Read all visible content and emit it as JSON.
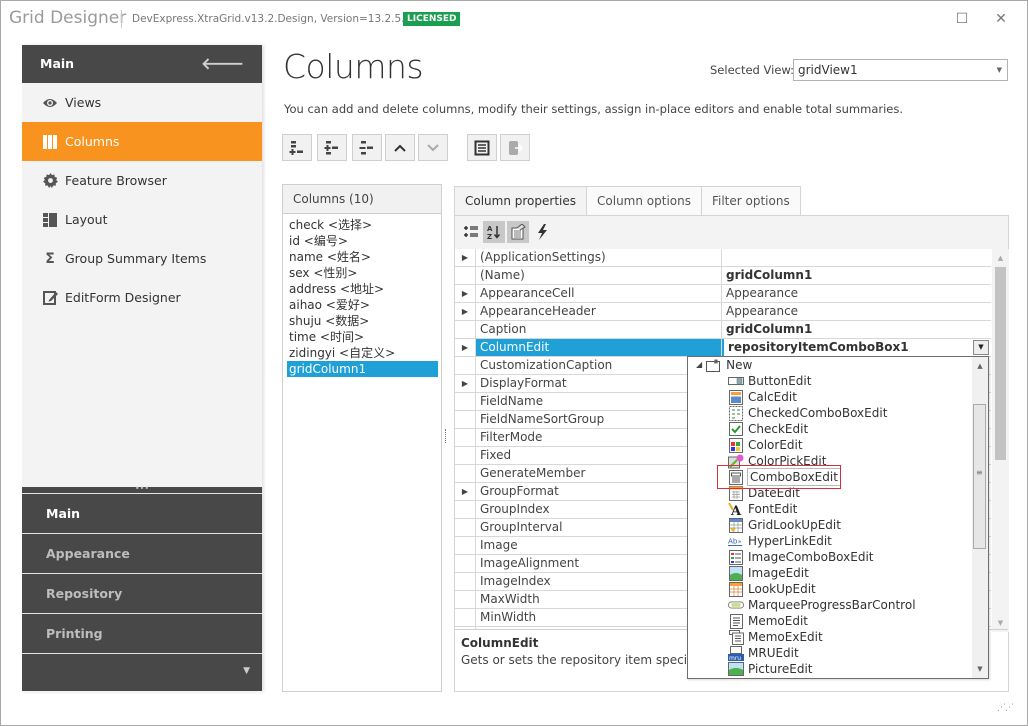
{
  "titlebar": {
    "app_title": "Grid Designer",
    "version": "DevExpress.XtraGrid.v13.2.Design, Version=13.2.5.0",
    "license_badge": "LICENSED",
    "maximize_glyph": "☐",
    "close_glyph": "✕"
  },
  "sidebar": {
    "header": "Main",
    "back_glyph": "🡐",
    "items": [
      {
        "label": "Views",
        "icon": "eye-icon",
        "active": false
      },
      {
        "label": "Columns",
        "icon": "columns-icon",
        "active": true
      },
      {
        "label": "Feature Browser",
        "icon": "gear-icon",
        "active": false
      },
      {
        "label": "Layout",
        "icon": "layout-icon",
        "active": false
      },
      {
        "label": "Group Summary Items",
        "icon": "sigma-icon",
        "active": false
      },
      {
        "label": "EditForm Designer",
        "icon": "edit-form-icon",
        "active": false
      }
    ],
    "groups": [
      {
        "label": "Main",
        "active": true
      },
      {
        "label": "Appearance",
        "active": false
      },
      {
        "label": "Repository",
        "active": false
      },
      {
        "label": "Printing",
        "active": false
      }
    ],
    "grip_glyph": "•••",
    "more_glyph": "▼"
  },
  "main": {
    "title": "Columns",
    "selected_view_label": "Selected View:",
    "selected_view_value": "gridView1",
    "description": "You can add and delete columns, modify their settings, assign in-place editors and enable total summaries.",
    "toolbar": [
      {
        "name": "add-column",
        "icon": "add-column-icon"
      },
      {
        "name": "insert-column",
        "icon": "insert-column-icon"
      },
      {
        "name": "remove-column",
        "icon": "remove-column-icon"
      },
      {
        "name": "move-up",
        "icon": "chevron-up-icon",
        "glyph": "⌃"
      },
      {
        "name": "move-down",
        "icon": "chevron-down-icon",
        "glyph": "⌄",
        "disabled": true
      },
      {
        "name": "retrieve-fields",
        "icon": "form-icon"
      },
      {
        "name": "export",
        "icon": "export-icon",
        "disabled": true
      }
    ]
  },
  "columns_list": {
    "header": "Columns (10)",
    "items": [
      "check <选择>",
      "id <编号>",
      "name <姓名>",
      "sex <性别>",
      "address <地址>",
      "aihao <爱好>",
      "shuju <数据>",
      "time <时间>",
      "zidingyi <自定义>",
      "gridColumn1"
    ],
    "selected_index": 9
  },
  "tabs": [
    {
      "label": "Column properties",
      "active": true
    },
    {
      "label": "Column options",
      "active": false
    },
    {
      "label": "Filter options",
      "active": false
    }
  ],
  "property_grid": {
    "tools": [
      {
        "name": "categorized",
        "icon": "categorized-icon",
        "on": false
      },
      {
        "name": "alphabetical",
        "icon": "sort-az-icon",
        "on": true
      },
      {
        "name": "properties",
        "icon": "properties-icon",
        "on": true
      },
      {
        "name": "events",
        "icon": "lightning-icon",
        "on": false
      }
    ],
    "rows": [
      {
        "name": "(ApplicationSettings)",
        "value": "",
        "expandable": true,
        "bold": false
      },
      {
        "name": "(Name)",
        "value": "gridColumn1",
        "expandable": false,
        "bold": true
      },
      {
        "name": "AppearanceCell",
        "value": "Appearance",
        "expandable": true,
        "bold": false
      },
      {
        "name": "AppearanceHeader",
        "value": "Appearance",
        "expandable": true,
        "bold": false
      },
      {
        "name": "Caption",
        "value": "gridColumn1",
        "expandable": false,
        "bold": true
      },
      {
        "name": "ColumnEdit",
        "value": "repositoryItemComboBox1",
        "expandable": true,
        "bold": true,
        "selected": true
      },
      {
        "name": "CustomizationCaption",
        "value": "",
        "expandable": false,
        "bold": false
      },
      {
        "name": "DisplayFormat",
        "value": "",
        "expandable": true,
        "bold": false
      },
      {
        "name": "FieldName",
        "value": "",
        "expandable": false,
        "bold": false
      },
      {
        "name": "FieldNameSortGroup",
        "value": "",
        "expandable": false,
        "bold": false
      },
      {
        "name": "FilterMode",
        "value": "",
        "expandable": false,
        "bold": false
      },
      {
        "name": "Fixed",
        "value": "",
        "expandable": false,
        "bold": false
      },
      {
        "name": "GenerateMember",
        "value": "",
        "expandable": false,
        "bold": false
      },
      {
        "name": "GroupFormat",
        "value": "",
        "expandable": true,
        "bold": false
      },
      {
        "name": "GroupIndex",
        "value": "",
        "expandable": false,
        "bold": false
      },
      {
        "name": "GroupInterval",
        "value": "",
        "expandable": false,
        "bold": false
      },
      {
        "name": "Image",
        "value": "",
        "expandable": false,
        "bold": false
      },
      {
        "name": "ImageAlignment",
        "value": "",
        "expandable": false,
        "bold": false
      },
      {
        "name": "ImageIndex",
        "value": "",
        "expandable": false,
        "bold": false
      },
      {
        "name": "MaxWidth",
        "value": "",
        "expandable": false,
        "bold": false
      },
      {
        "name": "MinWidth",
        "value": "",
        "expandable": false,
        "bold": false
      },
      {
        "name": "MinWidth",
        "value": "",
        "expandable": false,
        "bold": false
      }
    ],
    "description_title": "ColumnEdit",
    "description_text": "Gets or sets the repository item specifyin"
  },
  "editor_dropdown": {
    "root": "New",
    "items": [
      {
        "label": "ButtonEdit",
        "icon": "button-edit-icon"
      },
      {
        "label": "CalcEdit",
        "icon": "calculator-icon"
      },
      {
        "label": "CheckedComboBoxEdit",
        "icon": "checked-combo-icon"
      },
      {
        "label": "CheckEdit",
        "icon": "checkbox-icon"
      },
      {
        "label": "ColorEdit",
        "icon": "color-edit-icon"
      },
      {
        "label": "ColorPickEdit",
        "icon": "color-pick-icon"
      },
      {
        "label": "ComboBoxEdit",
        "icon": "combobox-icon",
        "highlighted": true
      },
      {
        "label": "DateEdit",
        "icon": "calendar-icon"
      },
      {
        "label": "FontEdit",
        "icon": "font-icon"
      },
      {
        "label": "GridLookUpEdit",
        "icon": "grid-lookup-icon"
      },
      {
        "label": "HyperLinkEdit",
        "icon": "hyperlink-icon"
      },
      {
        "label": "ImageComboBoxEdit",
        "icon": "image-combo-icon"
      },
      {
        "label": "ImageEdit",
        "icon": "image-edit-icon"
      },
      {
        "label": "LookUpEdit",
        "icon": "lookup-icon"
      },
      {
        "label": "MarqueeProgressBarControl",
        "icon": "marquee-progress-icon"
      },
      {
        "label": "MemoEdit",
        "icon": "memo-icon"
      },
      {
        "label": "MemoExEdit",
        "icon": "memo-ex-icon"
      },
      {
        "label": "MRUEdit",
        "icon": "mru-icon"
      },
      {
        "label": "PictureEdit",
        "icon": "picture-icon"
      }
    ]
  }
}
